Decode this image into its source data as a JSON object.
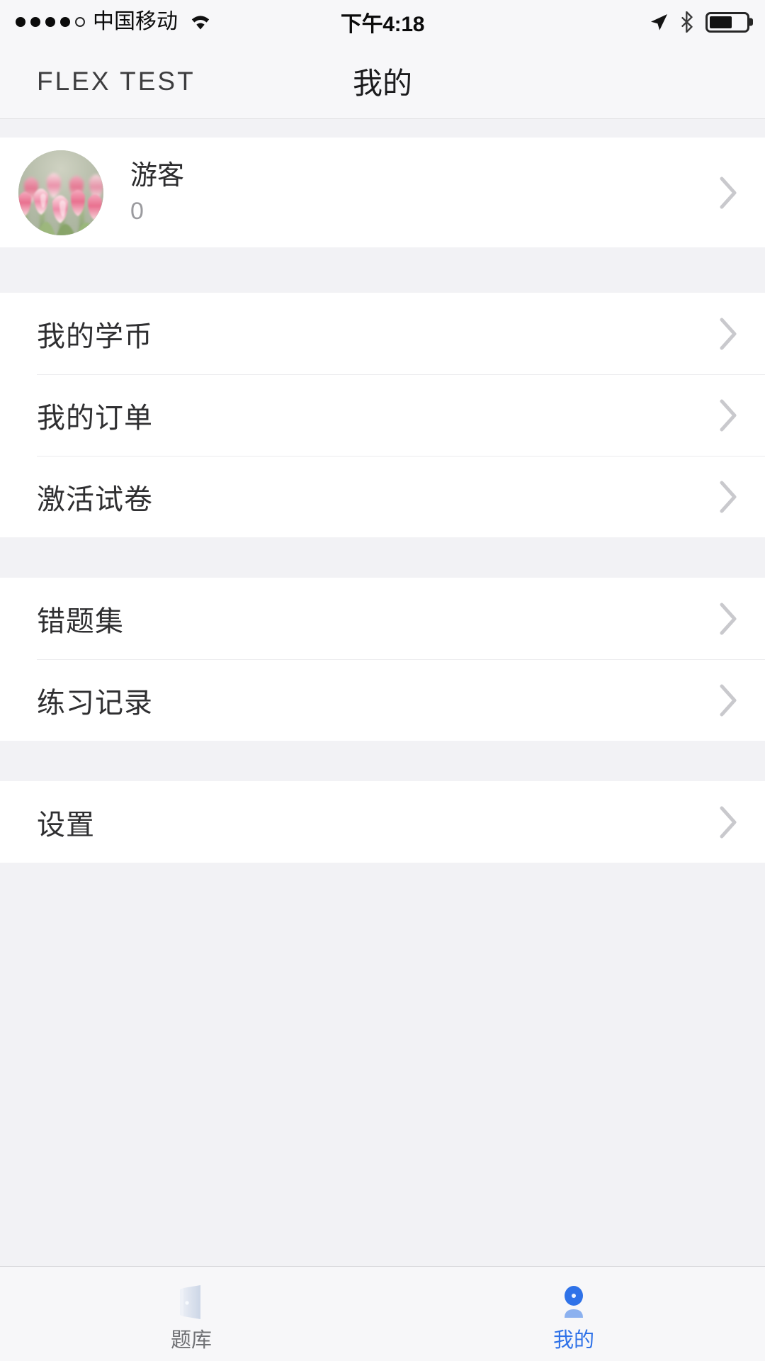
{
  "status_bar": {
    "signal_dots_total": 5,
    "signal_dots_filled": 4,
    "carrier": "中国移动",
    "wifi_icon": "wifi-icon",
    "time": "下午4:18",
    "location_icon": "location-arrow-icon",
    "bluetooth_icon": "bluetooth-icon",
    "battery_icon": "battery-icon",
    "battery_percent": 62
  },
  "nav_bar": {
    "left_label": "FLEX  TEST",
    "title": "我的"
  },
  "profile": {
    "avatar_alt": "tulips-avatar",
    "name": "游客",
    "count": "0",
    "chevron_icon": "chevron-right-icon"
  },
  "groups": [
    {
      "items": [
        {
          "label": "我的学币",
          "chevron_icon": "chevron-right-icon"
        },
        {
          "label": "我的订单",
          "chevron_icon": "chevron-right-icon"
        },
        {
          "label": "激活试卷",
          "chevron_icon": "chevron-right-icon"
        }
      ]
    },
    {
      "items": [
        {
          "label": "错题集",
          "chevron_icon": "chevron-right-icon"
        },
        {
          "label": "练习记录",
          "chevron_icon": "chevron-right-icon"
        }
      ]
    },
    {
      "items": [
        {
          "label": "设置",
          "chevron_icon": "chevron-right-icon"
        }
      ]
    }
  ],
  "tab_bar": {
    "tabs": [
      {
        "label": "题库",
        "icon": "book-icon",
        "active": false
      },
      {
        "label": "我的",
        "icon": "person-icon",
        "active": true
      }
    ],
    "active_color": "#2f72e8",
    "inactive_color": "#6f7074"
  },
  "colors": {
    "page_background": "#f2f2f5",
    "card_background": "#ffffff",
    "bar_background": "#f7f7f9",
    "primary_text": "#2f2f31",
    "secondary_text": "#9b9b9f",
    "separator": "#ececee",
    "chevron": "#c9c9cd",
    "accent": "#2f72e8"
  }
}
